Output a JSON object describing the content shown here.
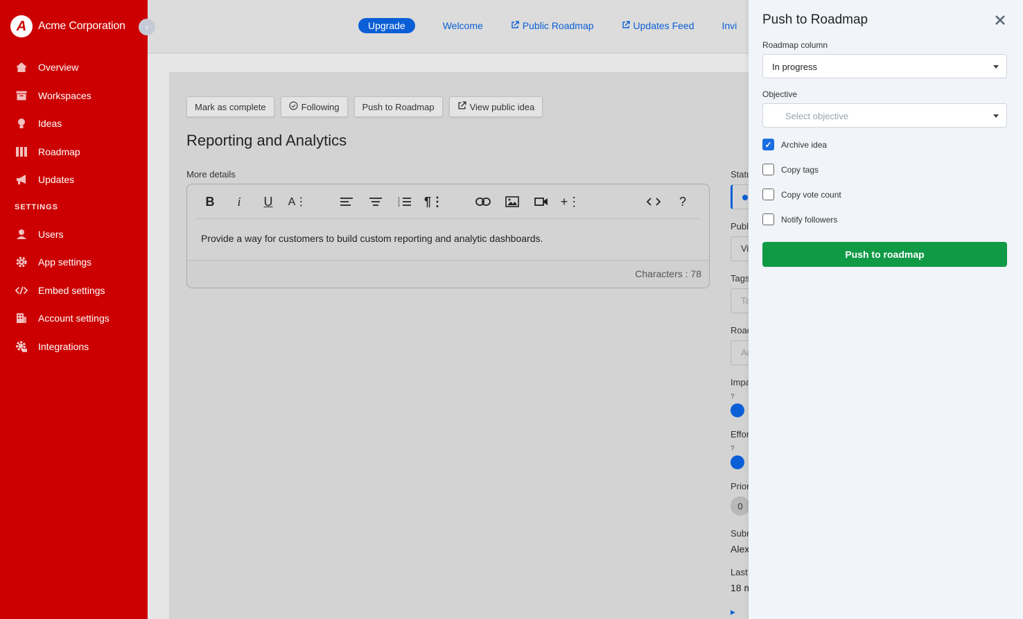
{
  "sidebar": {
    "brand_initial": "A",
    "brand_name": "Acme Corporation",
    "items": [
      {
        "label": "Overview",
        "icon": "home-icon"
      },
      {
        "label": "Workspaces",
        "icon": "inbox-icon"
      },
      {
        "label": "Ideas",
        "icon": "lightbulb-icon"
      },
      {
        "label": "Roadmap",
        "icon": "columns-icon"
      },
      {
        "label": "Updates",
        "icon": "megaphone-icon"
      }
    ],
    "settings_heading": "SETTINGS",
    "settings_items": [
      {
        "label": "Users",
        "icon": "user-icon"
      },
      {
        "label": "App settings",
        "icon": "gear-icon"
      },
      {
        "label": "Embed settings",
        "icon": "code-icon"
      },
      {
        "label": "Account settings",
        "icon": "building-icon"
      },
      {
        "label": "Integrations",
        "icon": "api-gear-icon"
      }
    ]
  },
  "header": {
    "upgrade": "Upgrade",
    "welcome": "Welcome",
    "public_roadmap": "Public Roadmap",
    "updates_feed": "Updates Feed",
    "invite_partial": "Invi"
  },
  "idea": {
    "actions": {
      "mark_complete": "Mark as complete",
      "following": "Following",
      "push_to_roadmap": "Push to Roadmap",
      "view_public": "View public idea"
    },
    "title": "Reporting and Analytics",
    "more_details_label": "More details",
    "description": "Provide a way for customers to build custom reporting and analytic dashboards.",
    "char_count": "Characters : 78"
  },
  "right_column": {
    "status": "Statu",
    "public": "Publ",
    "public_value": "Vi",
    "tags": "Tags",
    "tags_placeholder": "Ta",
    "roadmap": "Road",
    "roadmap_placeholder": "Ad",
    "impact": "Impa",
    "impact_q": "?",
    "effort": "Effor",
    "effort_q": "?",
    "priority": "Prior",
    "priority_value": "0",
    "submitted": "Subm",
    "submitted_value": "Alex",
    "last": "Last",
    "last_value": "18 m"
  },
  "panel": {
    "title": "Push to Roadmap",
    "roadmap_column_label": "Roadmap column",
    "roadmap_column_value": "In progress",
    "objective_label": "Objective",
    "objective_placeholder": "Select objective",
    "checkboxes": [
      {
        "label": "Archive idea",
        "checked": true
      },
      {
        "label": "Copy tags",
        "checked": false
      },
      {
        "label": "Copy vote count",
        "checked": false
      },
      {
        "label": "Notify followers",
        "checked": false
      }
    ],
    "push_button": "Push to roadmap"
  },
  "colors": {
    "sidebar": "#cc0000",
    "accent": "#0b5fd6",
    "push_button": "#119a46"
  }
}
